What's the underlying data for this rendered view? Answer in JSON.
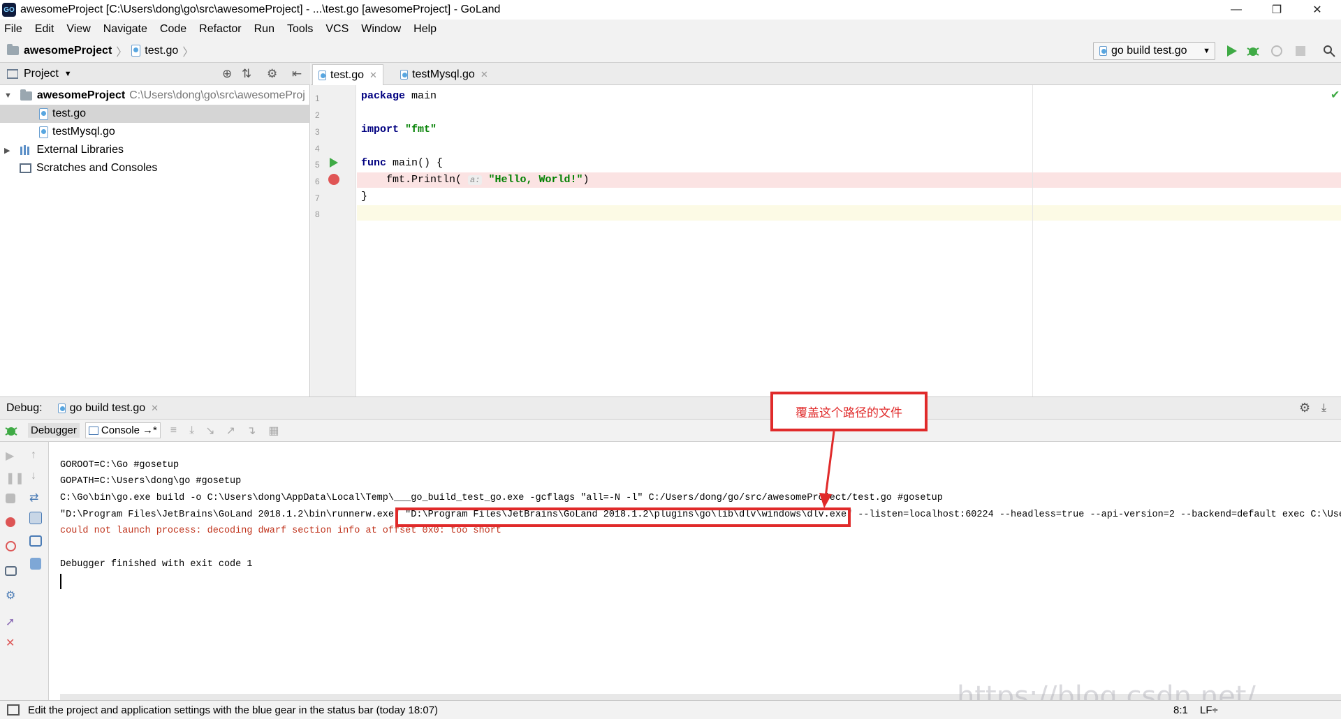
{
  "window": {
    "title": "awesomeProject [C:\\Users\\dong\\go\\src\\awesomeProject] - ...\\test.go [awesomeProject] - GoLand",
    "app_icon_text": "GO"
  },
  "menu": [
    "File",
    "Edit",
    "View",
    "Navigate",
    "Code",
    "Refactor",
    "Run",
    "Tools",
    "VCS",
    "Window",
    "Help"
  ],
  "breadcrumb": {
    "project": "awesomeProject",
    "file": "test.go"
  },
  "toolbar": {
    "run_config": "go build test.go"
  },
  "project_panel": {
    "header": "Project",
    "root_name": "awesomeProject",
    "root_path": "C:\\Users\\dong\\go\\src\\awesomeProj",
    "items": [
      "test.go",
      "testMysql.go"
    ],
    "external": "External Libraries",
    "scratches": "Scratches and Consoles"
  },
  "editor": {
    "tabs": [
      "test.go",
      "testMysql.go"
    ],
    "line_numbers": [
      "1",
      "2",
      "3",
      "4",
      "5",
      "6",
      "7",
      "8"
    ],
    "code": {
      "l1_kw": "package",
      "l1_rest": " main",
      "l3_kw": "import",
      "l3_str": "\"fmt\"",
      "l5_kw": "func",
      "l5_rest": " main() {",
      "l6_pre": "    fmt.Println( ",
      "l6_hint": "a:",
      "l6_str": "\"Hello, World!\"",
      "l6_post": ")",
      "l7": "}"
    }
  },
  "debug": {
    "label": "Debug:",
    "session_tab": "go build test.go",
    "debugger_tab": "Debugger",
    "console_tab": "Console",
    "console_tab_suffix": "→*",
    "console": {
      "l1": "GOROOT=C:\\Go #gosetup",
      "l2": "GOPATH=C:\\Users\\dong\\go #gosetup",
      "l3": "C:\\Go\\bin\\go.exe build -o C:\\Users\\dong\\AppData\\Local\\Temp\\___go_build_test_go.exe -gcflags \"all=-N -l\" C:/Users/dong/go/src/awesomeProject/test.go #gosetup",
      "l4": "\"D:\\Program Files\\JetBrains\\GoLand 2018.1.2\\bin\\runnerw.exe\" \"D:\\Program Files\\JetBrains\\GoLand 2018.1.2\\plugins\\go\\lib\\dlv\\windows\\dlv.exe\" --listen=localhost:60224 --headless=true --api-version=2 --backend=default exec C:\\Users",
      "l5": "could not launch process: decoding dwarf section info at offset 0x0: too short",
      "l6": "Debugger finished with exit code 1"
    }
  },
  "annotation": {
    "text": "覆盖这个路径的文件",
    "color": "#e02a2a"
  },
  "status": {
    "message": "Edit the project and application settings with the blue gear in the status bar (today 18:07)",
    "position": "8:1",
    "line_sep": "LF÷"
  },
  "watermark": "https://blog.csdn.net/..."
}
